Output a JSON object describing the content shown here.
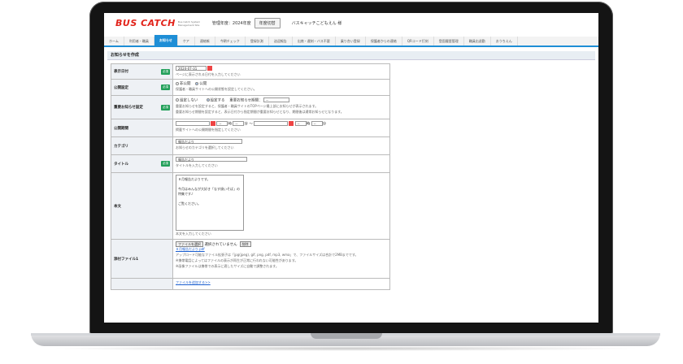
{
  "header": {
    "logo_text": "BUS CATCH",
    "logo_sub": "Bus Catch System Management Site",
    "fiscal_year": "管理年度：2024年度",
    "fiscal_switch": "年度切替",
    "org_name": "バスキャッチこどもえん 様"
  },
  "nav": {
    "items": [
      "ホーム",
      "利用者・職員",
      "お知らせ",
      "ケア",
      "連絡帳",
      "今朝チェック",
      "登録計測",
      "送迎報告",
      "出席・遅刻・バス不要",
      "乗り合い登録",
      "保護者からの連絡",
      "QRコード打刻",
      "登園履歴管理",
      "職員出退勤",
      "おうちえん"
    ]
  },
  "page": {
    "title": "お知らせを作成"
  },
  "required_badge": "必須",
  "form": {
    "date": {
      "label": "表示日付",
      "value": "2024-07-31",
      "hint": "ページに表示される日付を入力してください"
    },
    "publish": {
      "label": "公開設定",
      "option_private": "非公開",
      "option_public": "公開",
      "hint": "保護者・職員サイトへの公開状態を設定してください。"
    },
    "important": {
      "label": "重要お知らせ設定",
      "option_none": "設定しない",
      "option_set": "設定する",
      "period_label": "重要お知らせ期間：",
      "period_value": "--",
      "hint1": "重要お知らせを設定すると、保護者・職員サイトのTOPページ最上部にお知らせが表示されます。",
      "hint2": "重要お知らせ期間を設定すると、表示日付から指定期間が重要お知らせとなり、期間後は通常お知らせとなります。"
    },
    "period": {
      "label": "公開期間",
      "hour": "時",
      "minute": "分",
      "tilde": "〜",
      "dash": "--",
      "hint": "掲載サイトへの公開期間を指定してください"
    },
    "category": {
      "label": "カテゴリ",
      "value": "報告だより",
      "hint": "お知らせのカテゴリを選択してください"
    },
    "title": {
      "label": "タイトル",
      "value": "報告だより",
      "hint": "タイトルを入力してください"
    },
    "body": {
      "label": "本文",
      "line1": "８月報告だよりです。",
      "line2": "今月はみんなが大好き「なす焼いそば」の",
      "line3": "特集です♪",
      "line4": "ご覧ください。",
      "hint": "本文を入力してください"
    },
    "attachment": {
      "label": "添付ファイル1",
      "choose": "ファイルを選択",
      "none": "選択されていません",
      "delete": "削除",
      "file": "８月報告だより.pdf",
      "hint1": "アップロード可能なファイル拡張子は「jpg(jpeg), gif, png, pdf, mp3, wma」で、ファイルサイズは合計で2MBまでです。",
      "hint2": "※携帯電話によってはファイルの表示が再生が正常に行われない可能性があります。",
      "hint3": "※画像ファイルは携帯での表示に適したサイズに自動で調整されます。",
      "add": "ファイルを追加する>>"
    }
  },
  "colors": {
    "accent": "#1e8ed6",
    "brand": "#e2231a",
    "required": "#23a05a"
  }
}
